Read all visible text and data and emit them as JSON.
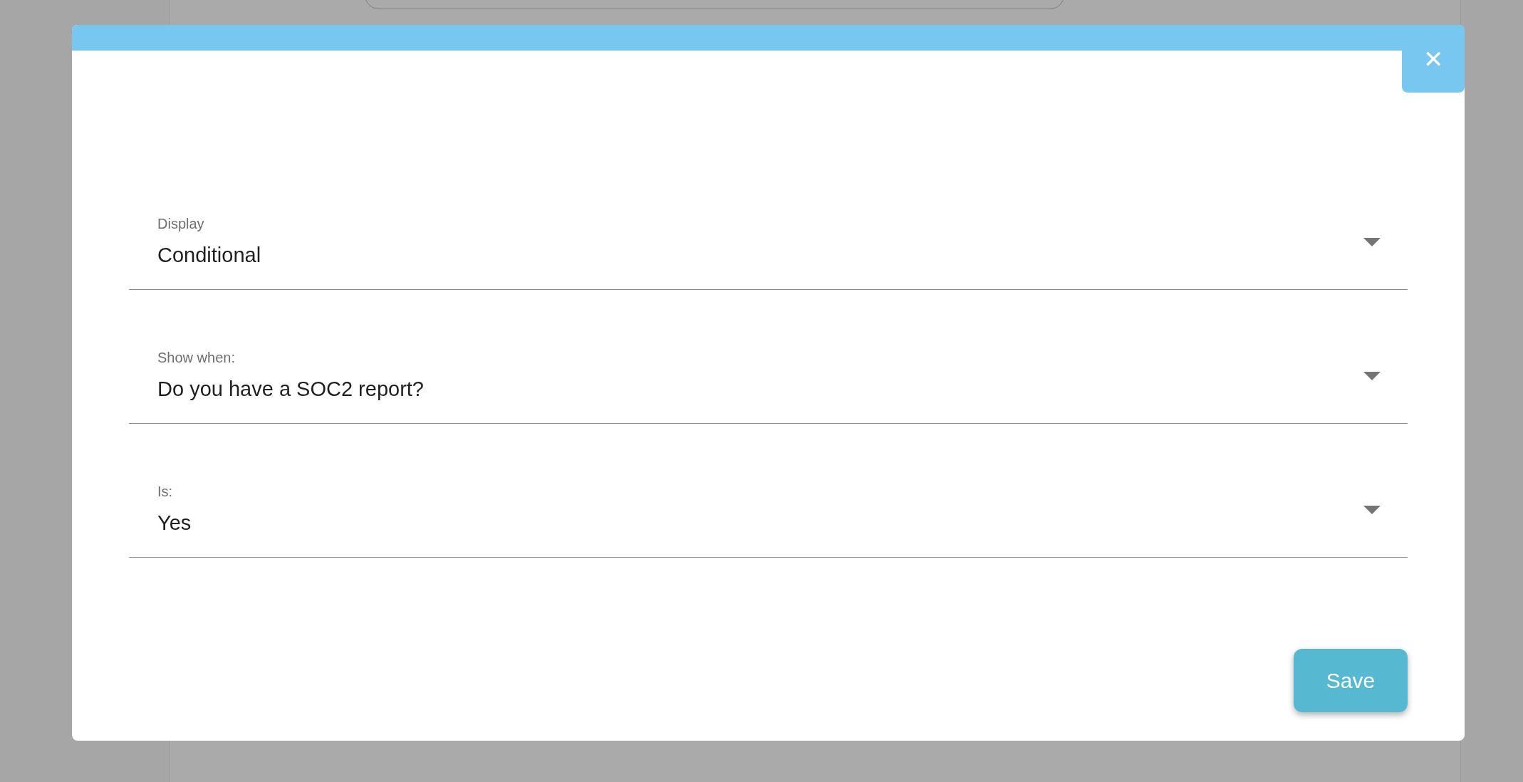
{
  "dialog": {
    "close_label": "✕",
    "fields": [
      {
        "label": "Display",
        "value": "Conditional"
      },
      {
        "label": "Show when:",
        "value": "Do you have a SOC2 report?"
      },
      {
        "label": "Is:",
        "value": "Yes"
      }
    ],
    "buttons": [
      "Save"
    ]
  }
}
